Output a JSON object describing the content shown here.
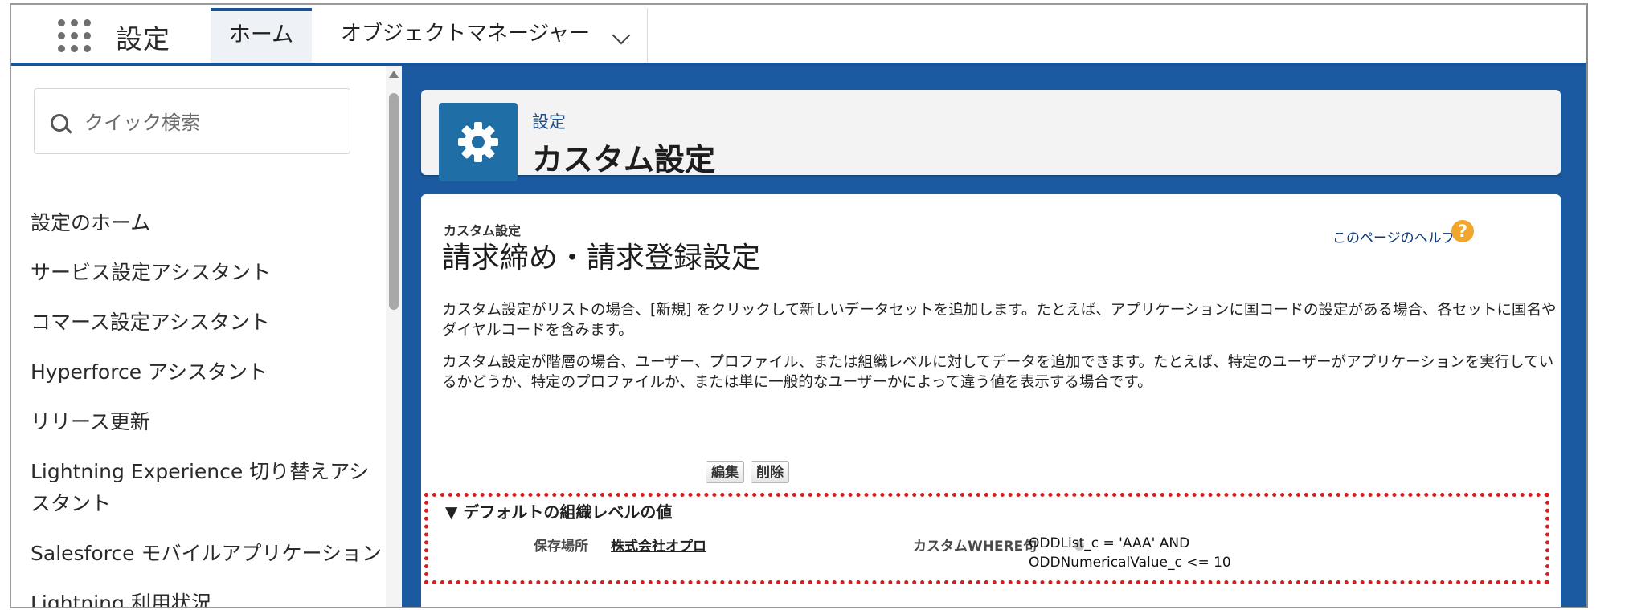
{
  "header": {
    "app_name": "設定",
    "tabs": [
      {
        "label": "ホーム"
      },
      {
        "label": "オブジェクトマネージャー"
      }
    ]
  },
  "sidebar": {
    "search_placeholder": "クイック検索",
    "items": [
      {
        "label": "設定のホーム"
      },
      {
        "label": "サービス設定アシスタント"
      },
      {
        "label": "コマース設定アシスタント"
      },
      {
        "label": "Hyperforce アシスタント"
      },
      {
        "label": "リリース更新"
      },
      {
        "label": "Lightning Experience 切り替えアシスタント"
      },
      {
        "label": "Salesforce モバイルアプリケーション"
      },
      {
        "label": "Lightning 利用状況"
      }
    ]
  },
  "page_header": {
    "breadcrumb": "設定",
    "title": "カスタム設定"
  },
  "detail": {
    "type_label": "カスタム設定",
    "name": "請求締め・請求登録設定",
    "help_link": "このページのヘルプ",
    "help_icon": "question-icon",
    "description_1": "カスタム設定がリストの場合、[新規] をクリックして新しいデータセットを追加します。たとえば、アプリケーションに国コードの設定がある場合、各セットに国名やダイヤルコードを含みます。",
    "description_2": "カスタム設定が階層の場合、ユーザー、プロファイル、または組織レベルに対してデータを追加できます。たとえば、特定のユーザーがアプリケーションを実行しているかどうか、特定のプロファイルか、または単に一般的なユーザーかによって違う値を表示する場合です。",
    "buttons": {
      "edit": "編集",
      "delete": "削除"
    },
    "section_title": "▼ デフォルトの組織レベルの値",
    "location_label": "保存場所",
    "location_value": "株式会社オプロ",
    "where_label": "カスタムWHERE句",
    "where_value_1": "ODDList_c = 'AAA' AND",
    "where_value_2": "ODDNumericalValue_c <= 10"
  },
  "colors": {
    "header_accent": "#1b5297",
    "content_background": "#1b5aa0",
    "setup_icon": "#1f6fa6",
    "highlight_border": "#d21f1f",
    "help_icon": "#f0a72b"
  }
}
